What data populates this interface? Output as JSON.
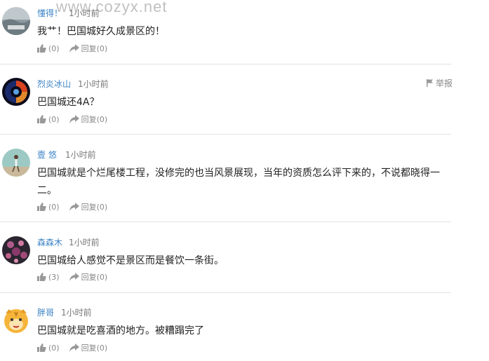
{
  "watermark": "www.cozyx.net",
  "colors": {
    "username": "#3a82c4",
    "divider": "#e3e3e3",
    "meta": "#888888"
  },
  "comments": [
    {
      "username": "懂得！",
      "time": "1小时前",
      "text": "我艹！巴国城好久成景区的！",
      "likes": "(0)",
      "reply": "回复(0)",
      "avatar": "landscape"
    },
    {
      "username": "烈炎冰山",
      "time": "1小时前",
      "text": "巴国城还4A？",
      "likes": "(0)",
      "reply": "回复(0)",
      "report": "举报",
      "avatar": "fire-ice-orb"
    },
    {
      "username": "壹 悠",
      "time": "1小时前",
      "text": "巴国城就是个烂尾楼工程，没修完的也当风景展现，当年的资质怎么评下来的，不说都晓得一二。",
      "likes": "(0)",
      "reply": "回复(0)",
      "avatar": "person-on-beach"
    },
    {
      "username": "森森木",
      "time": "1小时前",
      "text": "巴国城给人感觉不是景区而是餐饮一条街。",
      "likes": "(3)",
      "reply": "回复(0)",
      "avatar": "flowers"
    },
    {
      "username": "胖哥",
      "time": "1小时前",
      "text": "巴国城就是吃喜酒的地方。被糟蹋完了",
      "likes": "(0)",
      "reply": "回复(0)",
      "avatar": "cartoon-tiger"
    }
  ]
}
